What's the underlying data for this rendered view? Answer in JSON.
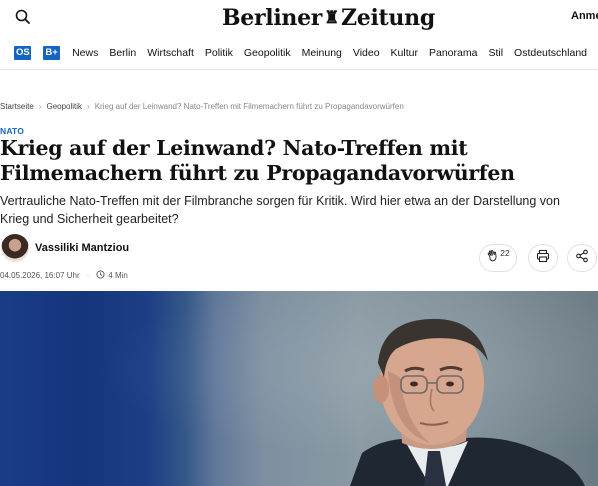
{
  "header": {
    "logo_text_left": "Berliner",
    "logo_text_right": "Zeitung",
    "login_label": "Anmel"
  },
  "icons": {
    "search": "search-icon",
    "crest": "bear-crest-icon",
    "clap": "clap-icon",
    "print": "printer-icon",
    "share": "share-icon",
    "clock": "clock-icon"
  },
  "nav": {
    "badges": [
      "OS",
      "B+"
    ],
    "items": [
      "News",
      "Berlin",
      "Wirtschaft",
      "Politik",
      "Geopolitik",
      "Meinung",
      "Video",
      "Kultur",
      "Panorama",
      "Stil",
      "Ostdeutschland"
    ]
  },
  "breadcrumb": {
    "items": [
      "Startseite",
      "Geopolitik"
    ],
    "current": "Krieg auf der Leinwand? Nato-Treffen mit Filmemachern führt zu Propagandavorwürfen"
  },
  "article": {
    "kicker": "NATO",
    "headline": "Krieg auf der Leinwand? Nato-Treffen mit Filmemachern führt zu Propagandavorwürfen",
    "lead": "Vertrauliche Nato-Treffen mit der Filmbranche sorgen für Kritik. Wird hier etwa an der Darstellung von Krieg und Sicherheit gearbeitet?",
    "author": "Vassiliki Mantziou",
    "date": "04.05.2026, 16:07 Uhr",
    "read_time": "4 Min",
    "clap_count": "22"
  },
  "colors": {
    "accent": "#1565c0",
    "text": "#111111",
    "muted": "#666666"
  }
}
